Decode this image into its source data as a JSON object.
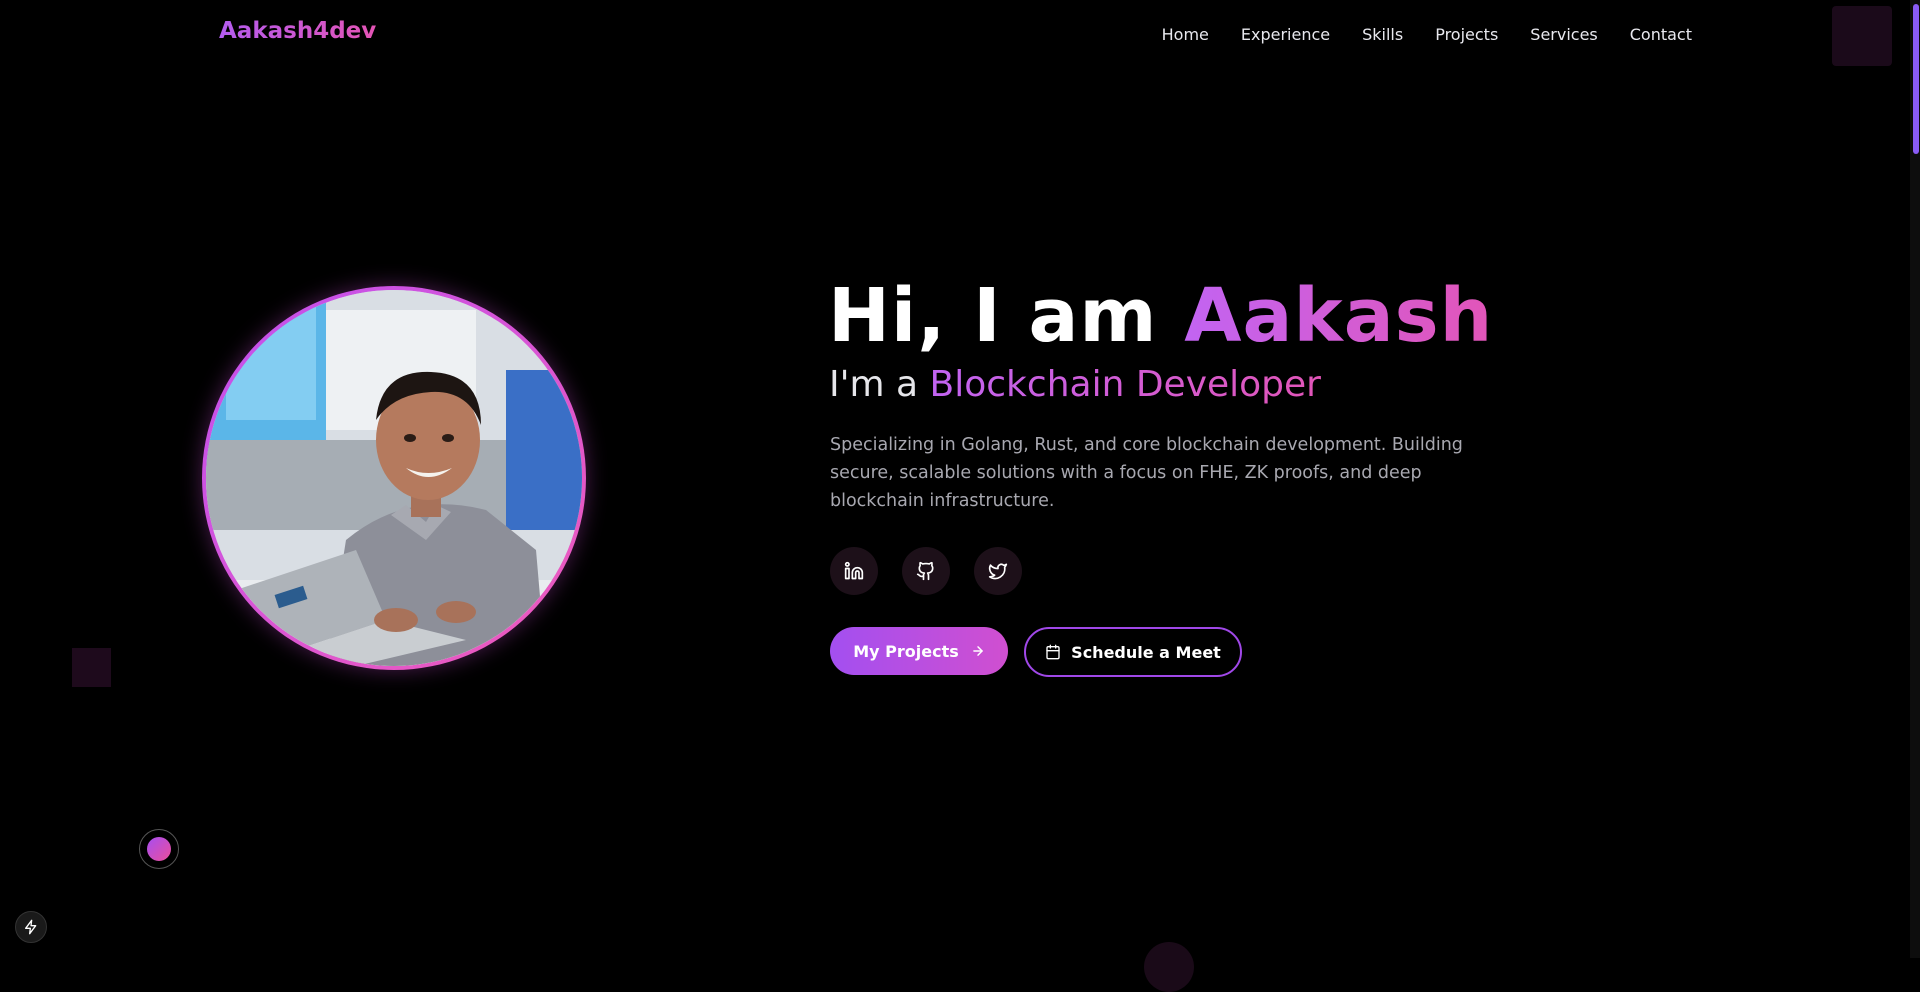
{
  "site": {
    "logo": "Aakash4dev"
  },
  "nav": {
    "items": [
      {
        "label": "Home"
      },
      {
        "label": "Experience"
      },
      {
        "label": "Skills"
      },
      {
        "label": "Projects"
      },
      {
        "label": "Services"
      },
      {
        "label": "Contact"
      }
    ]
  },
  "hero": {
    "greeting": "Hi, I am ",
    "name": "Aakash",
    "role_prefix": "I'm a ",
    "role": "Blockchain Developer",
    "description": "Specializing in Golang, Rust, and core blockchain development. Building secure, scalable solutions with a focus on FHE, ZK proofs, and deep blockchain infrastructure.",
    "socials": [
      {
        "icon": "linkedin-icon"
      },
      {
        "icon": "github-icon"
      },
      {
        "icon": "twitter-icon"
      }
    ],
    "primary_button": "My Projects",
    "secondary_button": "Schedule a Meet"
  },
  "colors": {
    "accent_purple": "#a34ff0",
    "accent_pink": "#e255b8",
    "background": "#000000"
  }
}
